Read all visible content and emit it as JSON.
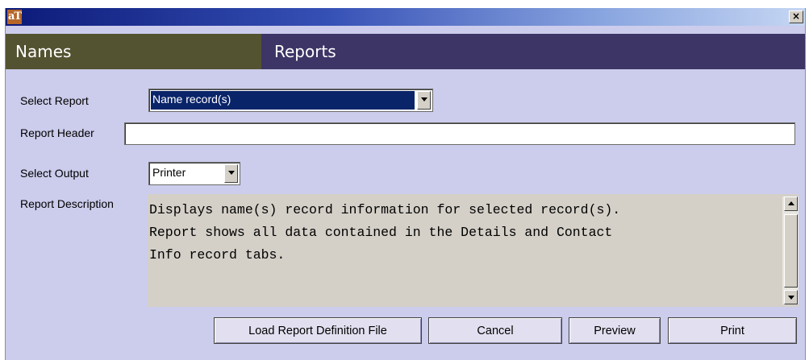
{
  "titlebar": {
    "logo_text": "aT",
    "close_label": "×"
  },
  "header": {
    "left_title": "Names",
    "right_title": "Reports",
    "colors": {
      "left_bg": "#545331",
      "right_bg": "#3c3566"
    }
  },
  "form": {
    "select_report": {
      "label": "Select Report",
      "value": "Name record(s)",
      "highlight_color": "#0a246a"
    },
    "report_header": {
      "label": "Report Header",
      "value": ""
    },
    "select_output": {
      "label": "Select Output",
      "value": "Printer"
    },
    "report_description": {
      "label": "Report Description",
      "text": "Displays name(s) record information for selected record(s).\nReport shows all data contained in the Details and Contact\nInfo record tabs."
    }
  },
  "buttons": {
    "load": "Load Report Definition File",
    "cancel": "Cancel",
    "preview": "Preview",
    "print": "Print"
  },
  "icons": {
    "close": "close-icon",
    "dropdown": "chevron-down-icon",
    "scroll_up": "arrow-up-icon",
    "scroll_down": "arrow-down-icon"
  }
}
